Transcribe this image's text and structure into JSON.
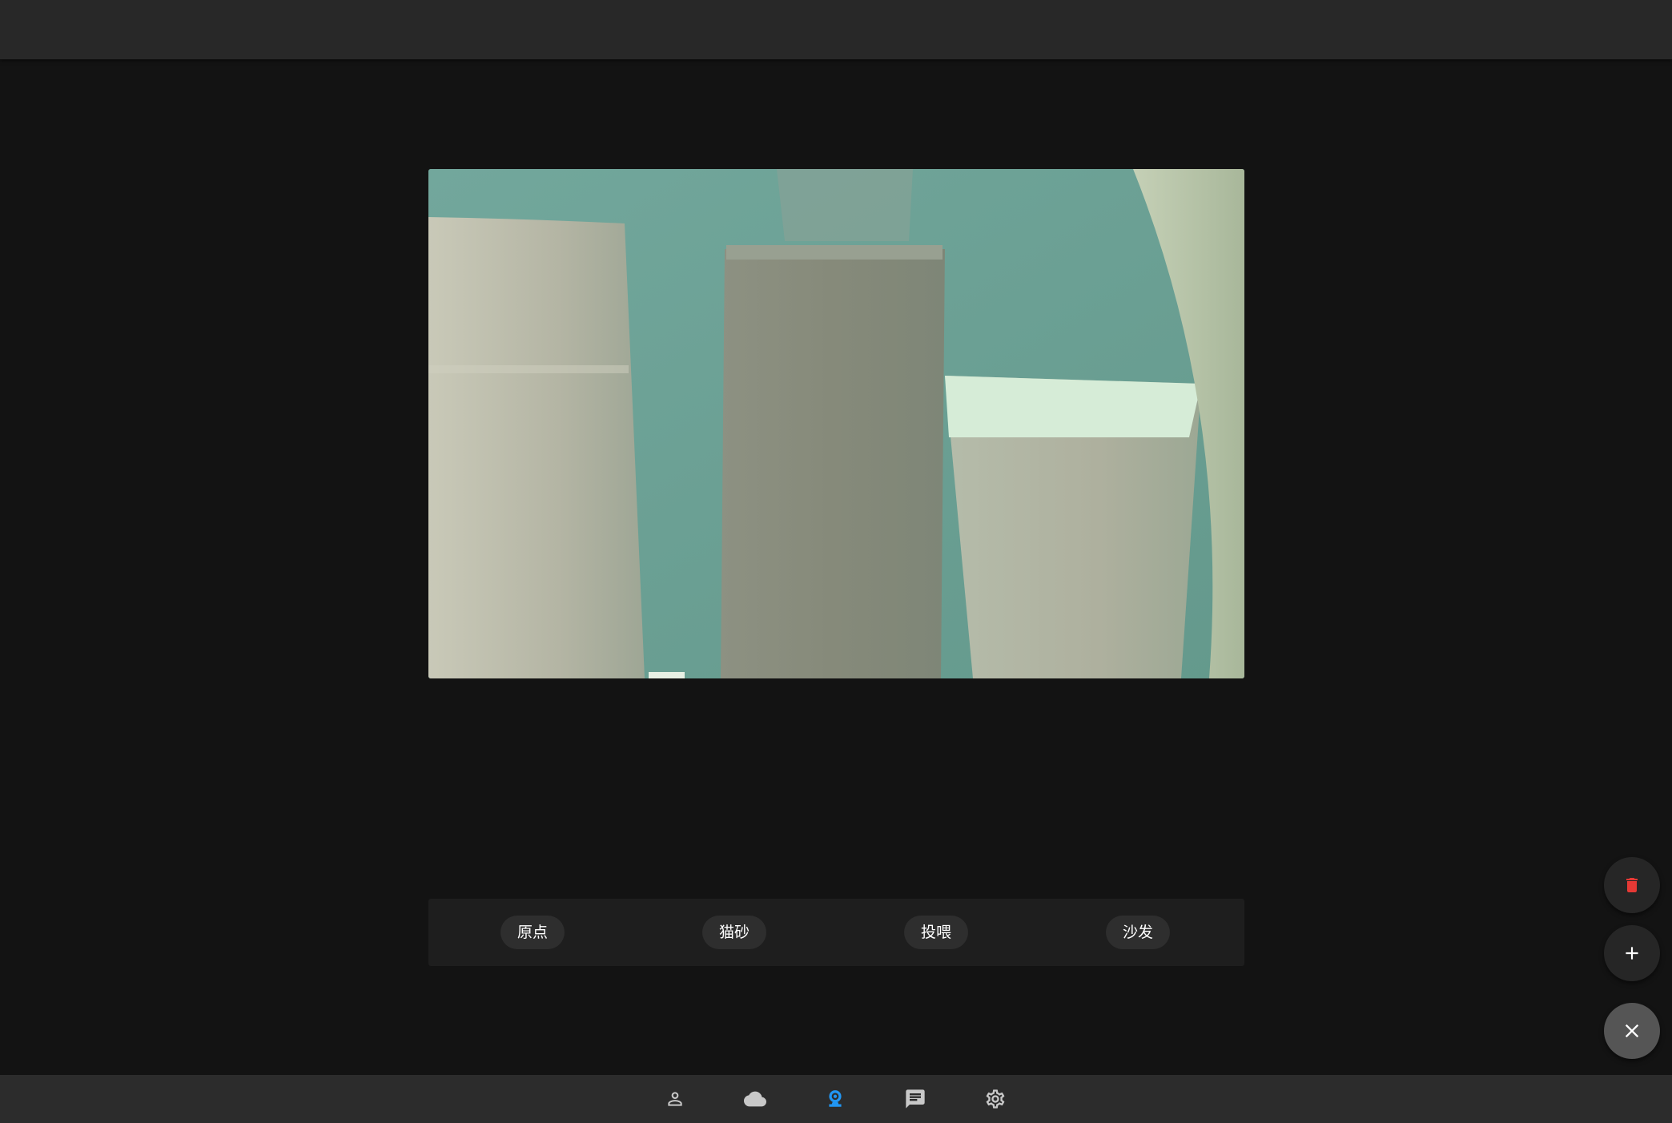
{
  "presets": [
    {
      "label": "原点"
    },
    {
      "label": "猫砂"
    },
    {
      "label": "投喂"
    },
    {
      "label": "沙发"
    }
  ],
  "fabs": [
    {
      "icon": "trash-icon",
      "color": "#e53935"
    },
    {
      "icon": "plus-icon",
      "color": "#ffffff"
    },
    {
      "icon": "close-icon",
      "color": "#ffffff"
    }
  ],
  "bottom_nav": {
    "items": [
      {
        "icon": "person-icon",
        "active": false
      },
      {
        "icon": "cloud-icon",
        "active": false
      },
      {
        "icon": "webcam-icon",
        "active": true
      },
      {
        "icon": "chat-icon",
        "active": false
      },
      {
        "icon": "gear-icon",
        "active": false
      }
    ],
    "active_color": "#2196f3",
    "inactive_color": "#c8c8c8"
  },
  "colors": {
    "background": "#131313",
    "top_bar": "#282828",
    "panel": "#1e1e1e",
    "chip": "#2e2e2e"
  }
}
